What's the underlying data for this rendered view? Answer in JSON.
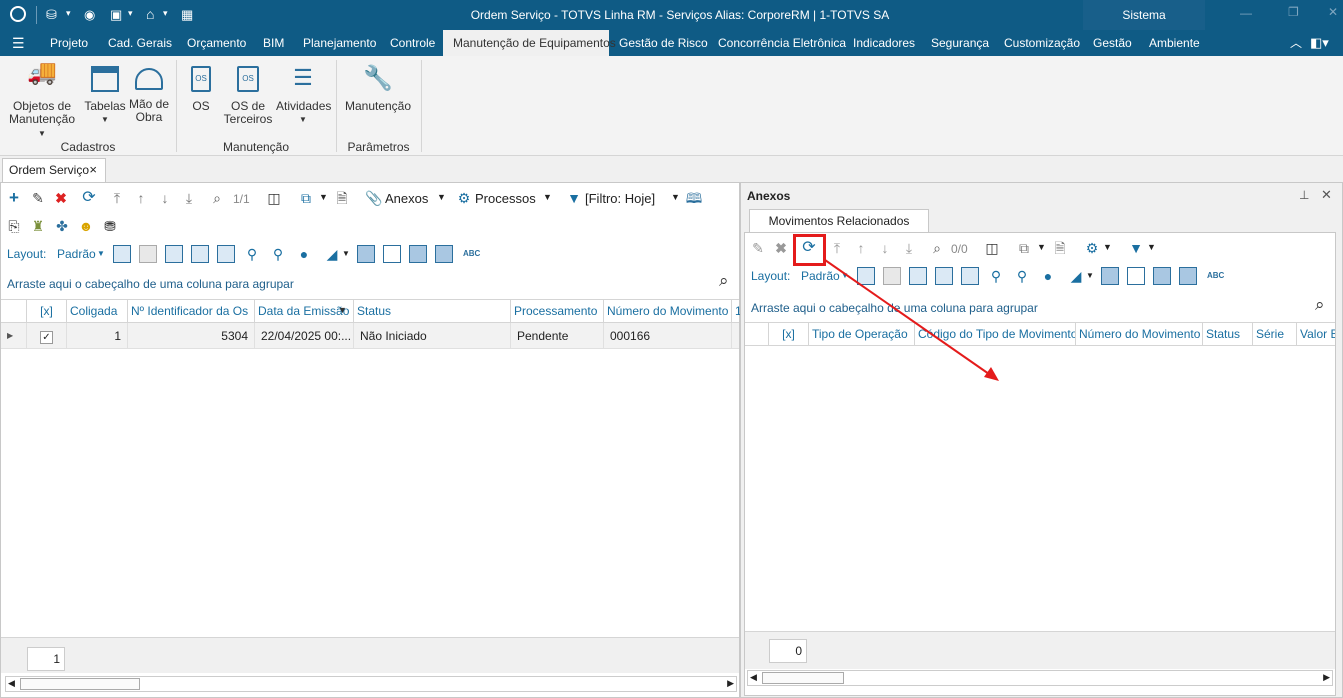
{
  "window": {
    "title": "Ordem Serviço - TOTVS Linha RM - Serviços  Alias: CorporeRM | 1-TOTVS SA",
    "system_label": "Sistema"
  },
  "menu": [
    "Projeto",
    "Cad. Gerais",
    "Orçamento",
    "BIM",
    "Planejamento",
    "Controle",
    "Manutenção de Equipamentos",
    "Gestão de Risco",
    "Concorrência Eletrônica",
    "Indicadores",
    "Segurança",
    "Customização",
    "Gestão",
    "Ambiente"
  ],
  "ribbon": {
    "buttons": [
      {
        "label1": "Objetos de",
        "label2": "Manutenção",
        "dropdown": true
      },
      {
        "label1": "Tabelas",
        "label2": "",
        "dropdown": true
      },
      {
        "label1": "Mão de",
        "label2": "Obra",
        "dropdown": false
      },
      {
        "label1": "OS",
        "label2": "",
        "dropdown": false
      },
      {
        "label1": "OS de",
        "label2": "Terceiros",
        "dropdown": false
      },
      {
        "label1": "Atividades",
        "label2": "",
        "dropdown": true
      },
      {
        "label1": "Manutenção",
        "label2": "",
        "dropdown": false
      }
    ],
    "groups": [
      "Cadastros",
      "Manutenção",
      "Parâmetros"
    ]
  },
  "doc_tab": {
    "label": "Ordem Serviço",
    "close": "×"
  },
  "left": {
    "record_counter": "1/1",
    "anexos": "Anexos",
    "processos": "Processos",
    "filtro": "[Filtro: Hoje]",
    "layout_label": "Layout:",
    "layout_value": "Padrão",
    "group_hint": "Arraste aqui o cabeçalho de uma coluna para agrupar",
    "columns": [
      "[x]",
      "Coligada",
      "Nº Identificador da Os",
      "Data da Emissão",
      "Status",
      "Processamento",
      "Número do Movimento",
      "1"
    ],
    "rows": [
      {
        "coligada": "1",
        "id": "5304",
        "data": "22/04/2025 00:...",
        "status": "Não Iniciado",
        "processamento": "Pendente",
        "movimento": "000166"
      }
    ],
    "footer_count": "1"
  },
  "right": {
    "panel_title": "Anexos",
    "tab": "Movimentos Relacionados",
    "record_counter": "0/0",
    "layout_label": "Layout:",
    "layout_value": "Padrão",
    "group_hint": "Arraste aqui o cabeçalho de uma coluna para agrupar",
    "columns": [
      "[x]",
      "Tipo de Operação",
      "Código do Tipo de Movimento",
      "Número do Movimento",
      "Status",
      "Série",
      "Valor B"
    ],
    "footer_count": "0"
  },
  "colors": {
    "brand": "#0f5b85",
    "accent": "#1a6fa1",
    "highlight": "#e41b1b"
  }
}
